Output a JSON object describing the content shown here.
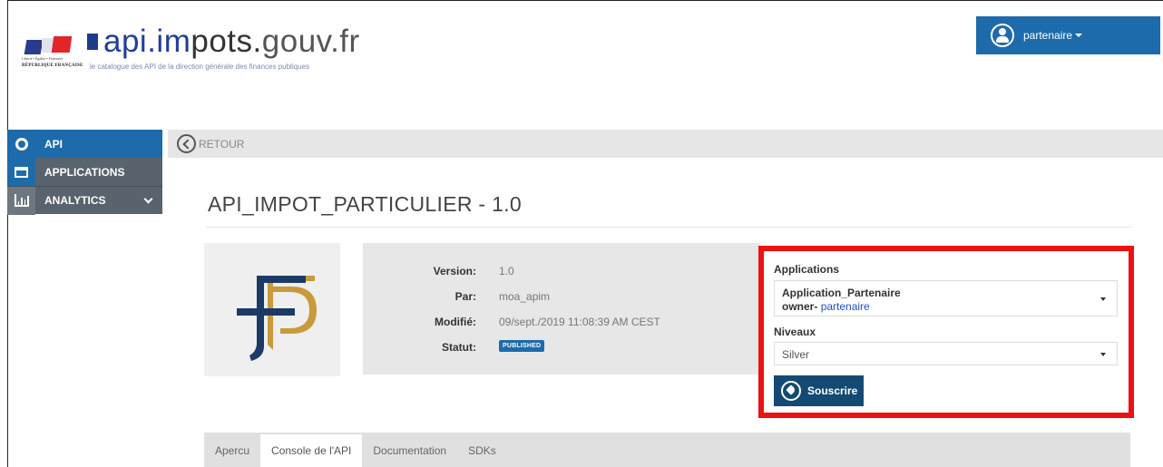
{
  "header": {
    "motto": "Liberté • Égalité • Fraternité",
    "republic": "RÉPUBLIQUE FRANÇAISE",
    "brand_part1": "api.im",
    "brand_part2": "pots.",
    "brand_part3": "gouv.fr",
    "subtitle": "le catalogue des API de la direction générale des finances publiques"
  },
  "user": {
    "name": "partenaire",
    "icon": "user-circle-icon"
  },
  "sidebar": {
    "items": [
      {
        "label": "API",
        "icon": "gear-icon",
        "active": true
      },
      {
        "label": "APPLICATIONS",
        "icon": "application-icon"
      },
      {
        "label": "ANALYTICS",
        "icon": "bar-chart-icon"
      }
    ]
  },
  "backbar": {
    "label": "RETOUR"
  },
  "api": {
    "title": "API_IMPOT_PARTICULIER - 1.0",
    "info": {
      "version_label": "Version:",
      "version_value": "1.0",
      "author_label": "Par:",
      "author_value": "moa_apim",
      "modified_label": "Modifié:",
      "modified_value": "09/sept./2019 11:08:39 AM CEST",
      "status_label": "Statut:",
      "status_value": "PUBLISHED"
    }
  },
  "subscribe": {
    "applications_label": "Applications",
    "application_name": "Application_Partenaire",
    "owner_prefix": "owner-",
    "owner_name": "partenaire",
    "levels_label": "Niveaux",
    "level_value": "Silver",
    "button_label": "Souscrire"
  },
  "tabs": [
    {
      "label": "Apercu",
      "active": false
    },
    {
      "label": "Console de l'API",
      "active": true
    },
    {
      "label": "Documentation",
      "active": false
    },
    {
      "label": "SDKs",
      "active": false
    }
  ],
  "colors": {
    "primary": "#1d6bab",
    "dark_button": "#134a73",
    "highlight": "#ee1111",
    "sidebar_gray": "#59636d",
    "logo_gold": "#c99a3b",
    "logo_navy": "#1d3a66"
  }
}
